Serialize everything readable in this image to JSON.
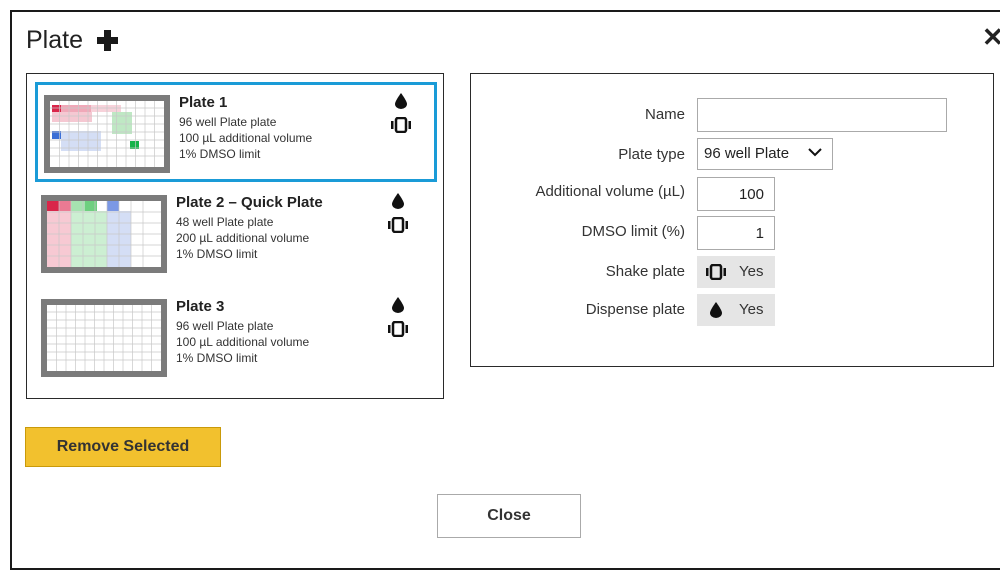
{
  "dialog": {
    "title": "Plate",
    "close_glyph": "✕"
  },
  "plates": [
    {
      "name": "Plate 1",
      "type_line": "96 well Plate plate",
      "volume_line": "100 µL additional volume",
      "dmso_line": "1% DMSO limit",
      "selected": true
    },
    {
      "name": "Plate 2 – Quick Plate",
      "type_line": "48 well Plate plate",
      "volume_line": "200 µL additional volume",
      "dmso_line": "1% DMSO limit",
      "selected": false
    },
    {
      "name": "Plate 3",
      "type_line": "96 well Plate plate",
      "volume_line": "100 µL additional volume",
      "dmso_line": "1% DMSO limit",
      "selected": false
    }
  ],
  "properties": {
    "name_label": "Name",
    "name_value": "",
    "plate_type_label": "Plate type",
    "plate_type_value": "96 well Plate",
    "additional_volume_label": "Additional volume (µL)",
    "additional_volume_value": "100",
    "dmso_label": "DMSO limit (%)",
    "dmso_value": "1",
    "shake_label": "Shake plate",
    "shake_value": "Yes",
    "dispense_label": "Dispense plate",
    "dispense_value": "Yes"
  },
  "buttons": {
    "remove_selected": "Remove Selected",
    "close": "Close"
  },
  "colors": {
    "selection_border": "#1a9bd7",
    "primary_button": "#f2c12e",
    "toggle_bg": "#e5e5e5"
  },
  "icons": {
    "add": "plus-icon",
    "close": "close-icon",
    "dispense": "drop-icon",
    "shake": "shake-icon",
    "dropdown": "chevron-down-icon"
  }
}
